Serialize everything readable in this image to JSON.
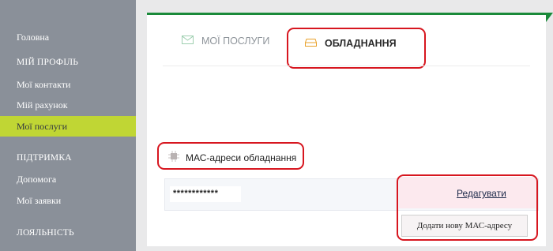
{
  "sidebar": {
    "home": "Головна",
    "profile_section": "МІЙ ПРОФІЛЬ",
    "contacts": "Мої контакти",
    "account": "Мій рахунок",
    "services": "Мої послуги",
    "support_section": "ПІДТРИМКА",
    "help": "Допомога",
    "requests": "Мої заявки",
    "loyalty_section": "ЛОЯЛЬНІСТЬ"
  },
  "tabs": {
    "services_label": "МОЇ ПОСЛУГИ",
    "equipment_label": "ОБЛАДНАННЯ"
  },
  "mac": {
    "title": "МАС-адреси обладнання",
    "value": "************",
    "edit_label": "Редагувати",
    "add_label": "Додати нову МАС-адресу"
  },
  "colors": {
    "accent_green": "#1a8a3a",
    "active_nav": "#c0d634",
    "highlight_red": "#d7161f"
  }
}
